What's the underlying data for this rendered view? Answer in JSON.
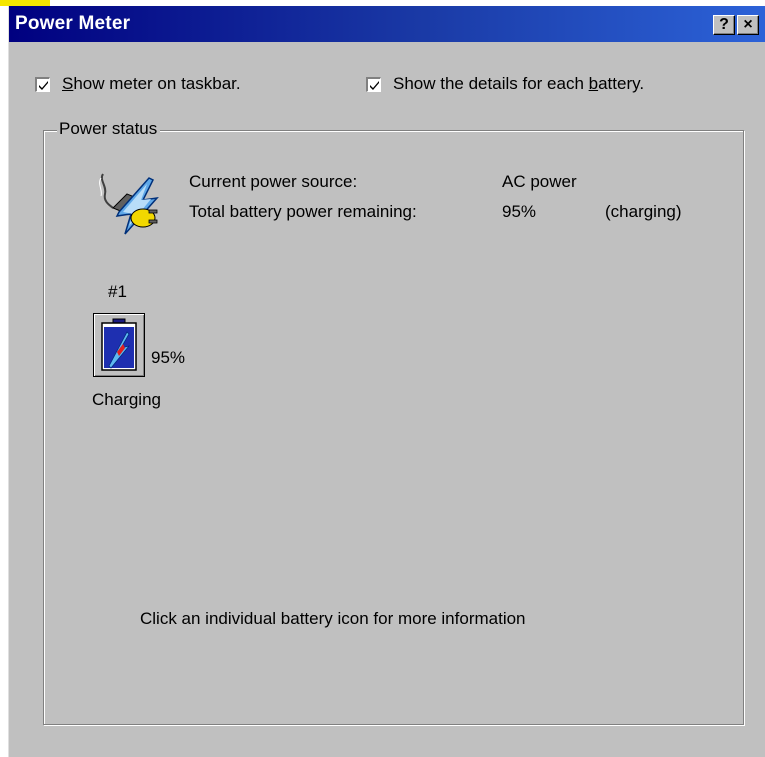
{
  "window": {
    "title": "Power Meter",
    "help_button": "?",
    "close_button": "×"
  },
  "options": {
    "show_meter_on_taskbar": {
      "label_prefix": "",
      "label_underlined": "S",
      "label_rest": "how meter on taskbar.",
      "checked": true
    },
    "show_battery_details": {
      "label_prefix": "Show the details for each ",
      "label_underlined": "b",
      "label_rest": "attery.",
      "checked": true
    }
  },
  "power_status": {
    "group_label": "Power status",
    "source_label": "Current power source:",
    "source_value": "AC power",
    "remaining_label": "Total battery power remaining:",
    "remaining_value": "95%",
    "remaining_state": "(charging)"
  },
  "battery": {
    "number": "#1",
    "percent": "95%",
    "status": "Charging",
    "charge_fraction": 0.95
  },
  "hint": "Click an individual battery icon for more information",
  "icons": [
    "plug-power-icon",
    "battery-icon",
    "check-icon"
  ]
}
